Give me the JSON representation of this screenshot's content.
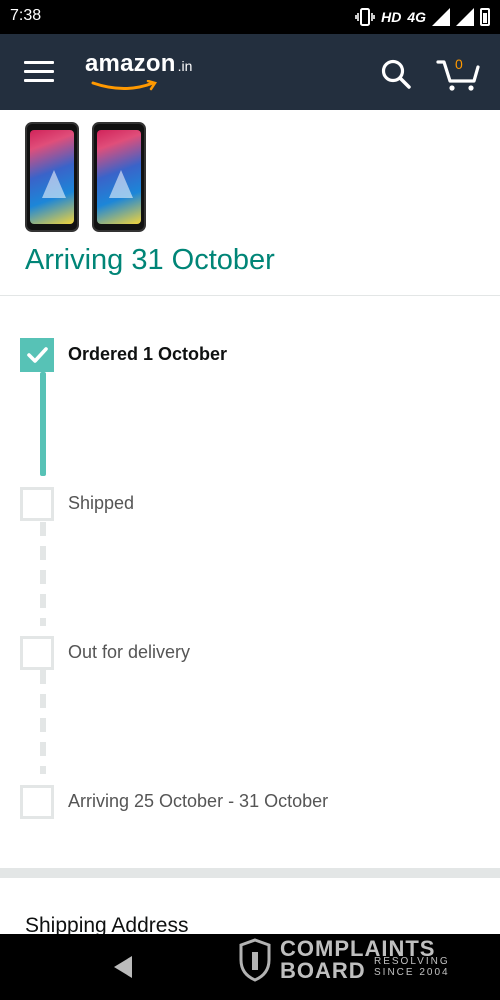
{
  "status_bar": {
    "time": "7:38",
    "network": "4G",
    "hd_label": "HD"
  },
  "header": {
    "logo_word": "amazon",
    "logo_tld": ".in",
    "cart_count": "0"
  },
  "order": {
    "arriving_title": "Arriving 31 October"
  },
  "timeline": [
    {
      "label": "Ordered 1 October",
      "completed": true
    },
    {
      "label": "Shipped",
      "completed": false
    },
    {
      "label": "Out for delivery",
      "completed": false
    },
    {
      "label": "Arriving 25 October - 31 October",
      "completed": false
    }
  ],
  "shipping": {
    "title": "Shipping Address"
  },
  "watermark": {
    "line1": "COMPLAINTS",
    "line2": "BOARD",
    "line3": "RESOLVING",
    "line4": "SINCE 2004"
  },
  "colors": {
    "header_bg": "#232f3e",
    "accent_teal": "#008577",
    "step_done": "#57c2b6",
    "cart_badge": "#ff9900"
  }
}
